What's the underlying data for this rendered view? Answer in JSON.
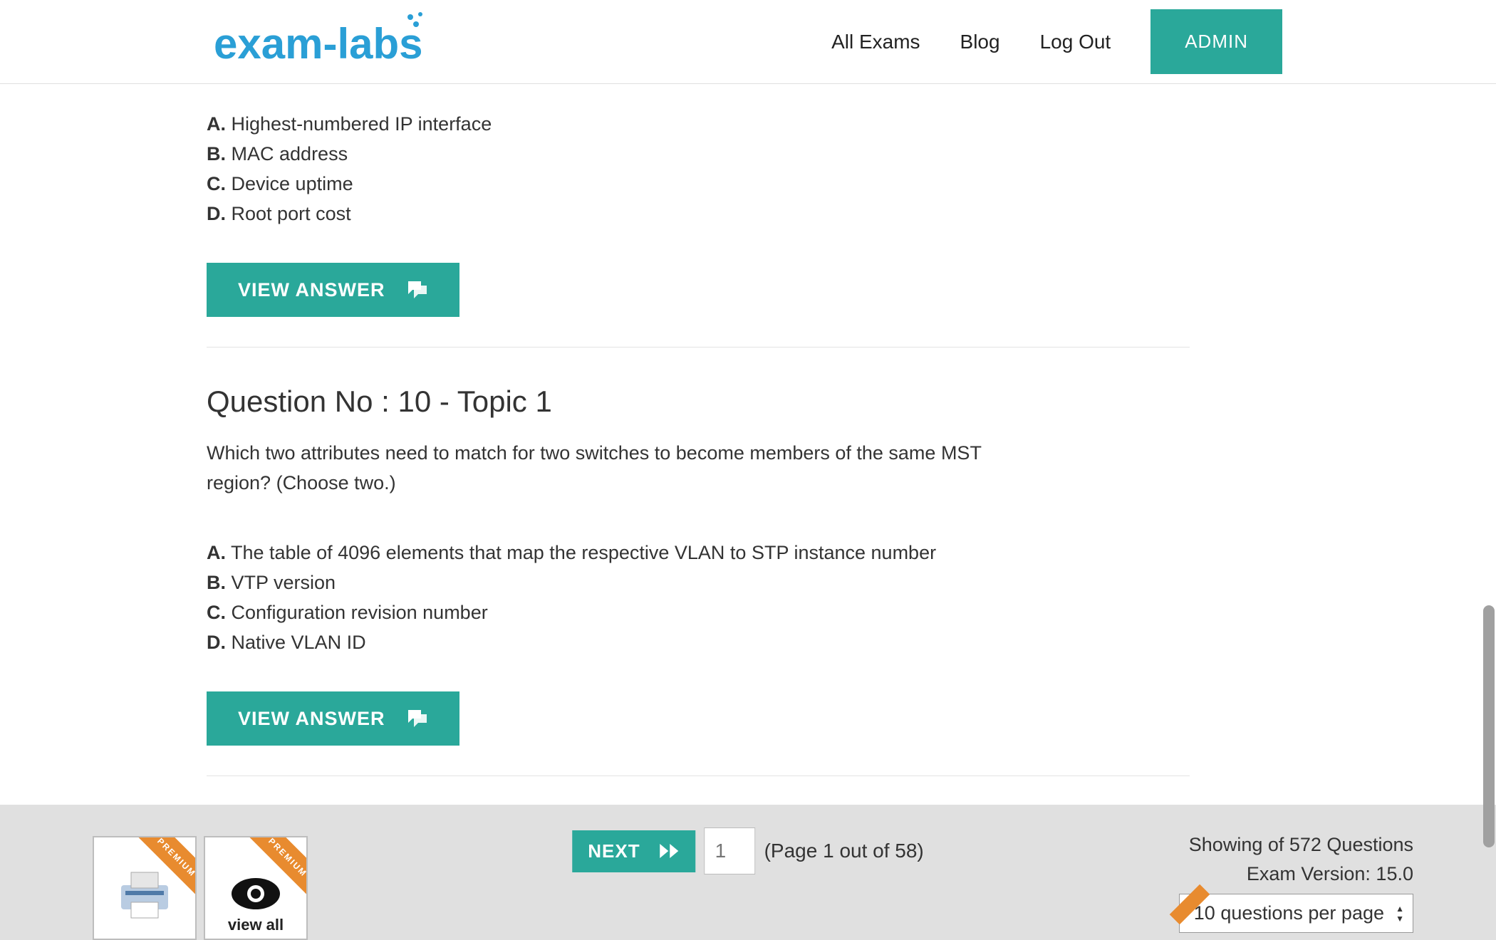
{
  "header": {
    "logo_text": "exam-labs",
    "nav": {
      "all_exams": "All Exams",
      "blog": "Blog",
      "logout": "Log Out",
      "admin": "ADMIN"
    }
  },
  "q9": {
    "options": [
      {
        "letter": "A.",
        "text": "Highest-numbered IP interface"
      },
      {
        "letter": "B.",
        "text": "MAC address"
      },
      {
        "letter": "C.",
        "text": "Device uptime"
      },
      {
        "letter": "D.",
        "text": "Root port cost"
      }
    ],
    "view_label": "VIEW ANSWER"
  },
  "q10": {
    "title": "Question No : 10 - Topic 1",
    "text": "Which two attributes need to match for two switches to become members of the same MST region? (Choose two.)",
    "options": [
      {
        "letter": "A.",
        "text": "The table of 4096 elements that map the respective VLAN to STP instance number"
      },
      {
        "letter": "B.",
        "text": "VTP version"
      },
      {
        "letter": "C.",
        "text": "Configuration revision number"
      },
      {
        "letter": "D.",
        "text": "Native VLAN ID"
      }
    ],
    "view_label": "VIEW ANSWER"
  },
  "footer": {
    "premium_badge": "PREMIUM",
    "view_all": "view all",
    "next_label": "NEXT",
    "page_value": "1",
    "page_info": "(Page 1 out of 58)",
    "showing": "Showing of 572 Questions",
    "version": "Exam Version: 15.0",
    "per_page": "10 questions per page"
  }
}
